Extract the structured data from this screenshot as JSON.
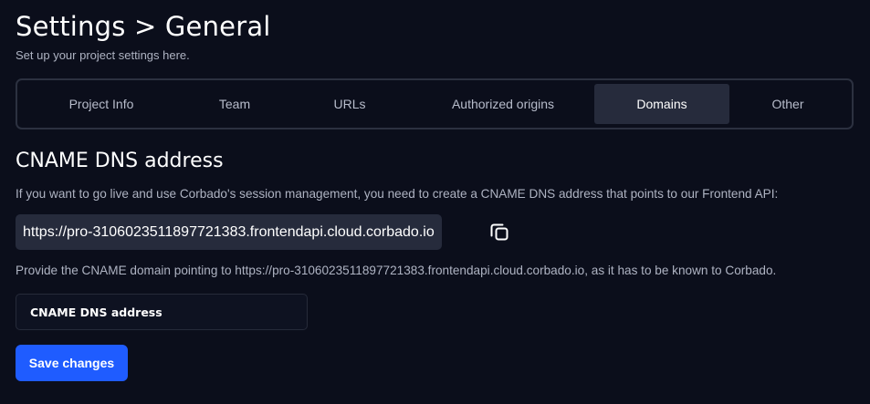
{
  "header": {
    "title": "Settings > General",
    "subtitle": "Set up your project settings here."
  },
  "tabs": [
    {
      "label": "Project Info",
      "active": false
    },
    {
      "label": "Team",
      "active": false
    },
    {
      "label": "URLs",
      "active": false
    },
    {
      "label": "Authorized origins",
      "active": false
    },
    {
      "label": "Domains",
      "active": true
    },
    {
      "label": "Other",
      "active": false
    }
  ],
  "cname_section": {
    "title": "CNAME DNS address",
    "description": "If you want to go live and use Corbado's session management, you need to create a CNAME DNS address that points to our Frontend API:",
    "frontend_api_url": "https://pro-3106023511897721383.frontendapi.cloud.corbado.io",
    "copy_icon": "copy-icon",
    "hint": "Provide the CNAME domain pointing to https://pro-3106023511897721383.frontendapi.cloud.corbado.io, as it has to be known to Corbado.",
    "input_value": "",
    "input_placeholder": "CNAME DNS address",
    "save_label": "Save changes"
  },
  "colors": {
    "background": "#0b0e1b",
    "active_tab": "#262b3c",
    "primary_button": "#1f5cff",
    "muted_text": "#aeb3c2"
  }
}
